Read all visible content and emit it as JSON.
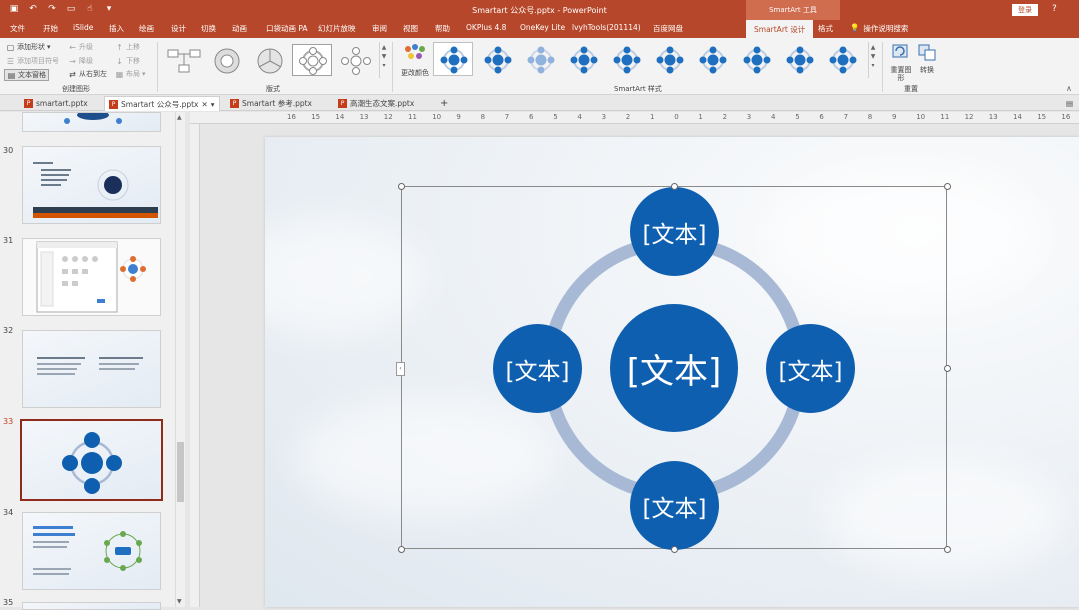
{
  "titlebar": {
    "title": "Smartart  公众号.pptx  -  PowerPoint",
    "context_group": "SmartArt 工具",
    "login": "登录",
    "help": "?"
  },
  "tabs": [
    "文件",
    "开始",
    "iSlide",
    "插入",
    "绘画",
    "设计",
    "切换",
    "动画",
    "口袋动画 PA",
    "幻灯片放映",
    "审阅",
    "视图",
    "帮助",
    "OKPlus 4.8",
    "OneKey Lite",
    "lvyhTools(201114)",
    "百度网盘",
    "SmartArt 设计",
    "格式"
  ],
  "tell_me": "操作说明搜索",
  "ribbon": {
    "create": {
      "add_shape": "添加形状",
      "add_bullet": "添加项目符号",
      "text_pane": "文本窗格",
      "promote": "升级",
      "demote": "降级",
      "right_to_left": "从右到左",
      "move_up": "上移",
      "move_down": "下移",
      "layout": "布局",
      "label": "创建图形"
    },
    "layouts_label": "版式",
    "change_colors": "更改颜色",
    "styles_label": "SmartArt 样式",
    "reset_graphic": "重置图形",
    "convert": "转换",
    "reset_label": "重置"
  },
  "doc_tabs": [
    {
      "name": "smartart.pptx"
    },
    {
      "name": "Smartart  公众号.pptx"
    },
    {
      "name": "Smartart  参考.pptx"
    },
    {
      "name": "高潮生态文案.pptx"
    }
  ],
  "ruler_labels": [
    "16",
    "15",
    "14",
    "13",
    "12",
    "11",
    "10",
    "9",
    "8",
    "7",
    "6",
    "5",
    "4",
    "3",
    "2",
    "1",
    "0",
    "1",
    "2",
    "3",
    "4",
    "5",
    "6",
    "7",
    "8",
    "9",
    "10",
    "11",
    "12",
    "13",
    "14",
    "15",
    "16"
  ],
  "slides": [
    {
      "num": "30"
    },
    {
      "num": "31"
    },
    {
      "num": "32"
    },
    {
      "num": "33"
    },
    {
      "num": "34"
    },
    {
      "num": "35"
    }
  ],
  "smartart": {
    "center_text": "[文本]",
    "top_text": "[文本]",
    "left_text": "[文本]",
    "right_text": "[文本]",
    "bottom_text": "[文本]",
    "circle_color": "#0f5fb0",
    "ring_color": "#a8b9d6"
  },
  "colors": {
    "accent": "#b7472a",
    "context_tab": "#d06d4f"
  }
}
